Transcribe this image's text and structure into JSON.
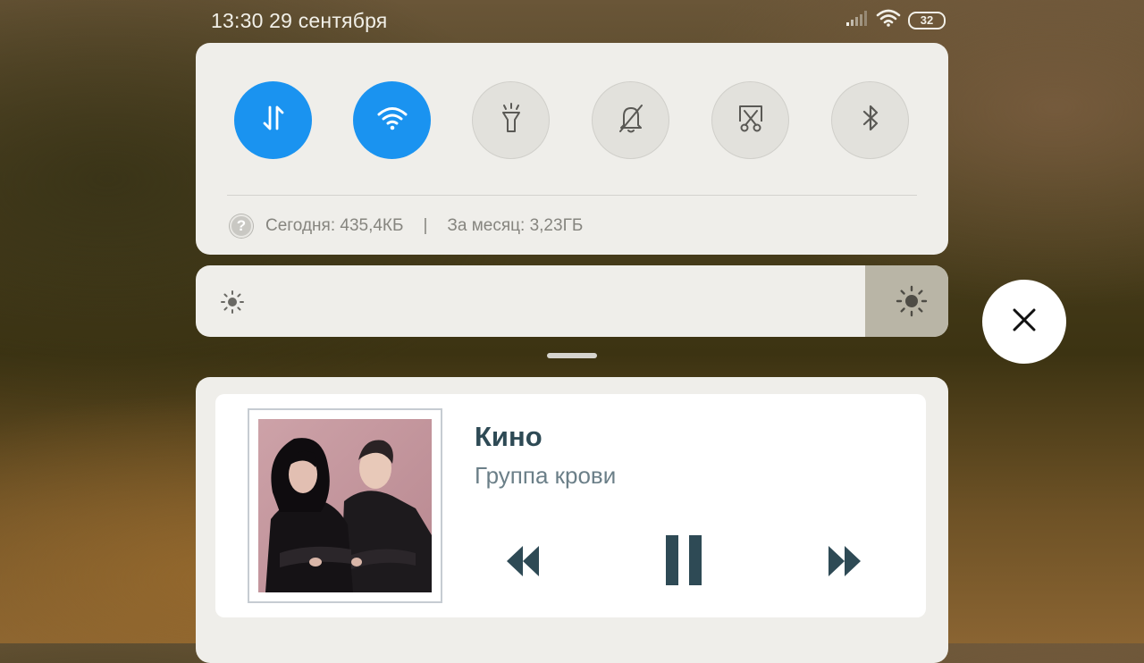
{
  "status_bar": {
    "time_date": "13:30 29 сентября",
    "battery": "32",
    "icons": [
      "signal-icon",
      "wifi-icon",
      "battery-icon"
    ]
  },
  "quick_settings": {
    "toggles": [
      {
        "name": "mobile-data",
        "icon": "mobile-data-icon",
        "state": "on"
      },
      {
        "name": "wifi",
        "icon": "wifi-icon",
        "state": "on"
      },
      {
        "name": "flashlight",
        "icon": "flashlight-icon",
        "state": "off"
      },
      {
        "name": "silent",
        "icon": "bell-off-icon",
        "state": "off"
      },
      {
        "name": "screenshot",
        "icon": "scissors-screenshot-icon",
        "state": "off"
      },
      {
        "name": "bluetooth",
        "icon": "bluetooth-icon",
        "state": "off"
      }
    ],
    "data_usage": {
      "help": "?",
      "today": "Сегодня: 435,4КБ",
      "separator": "|",
      "month": "За месяц: 3,23ГБ"
    }
  },
  "brightness": {
    "icon_low": "sun-small-icon",
    "icon_high": "sun-large-icon"
  },
  "media": {
    "artist": "Кино",
    "title": "Группа крови",
    "controls": [
      "rewind-icon",
      "pause-icon",
      "fast-forward-icon"
    ]
  },
  "colors": {
    "accent": "#1a93f0",
    "panel": "#efeeea",
    "media_text": "#2e4a55",
    "media_controls": "#2e4a55"
  }
}
